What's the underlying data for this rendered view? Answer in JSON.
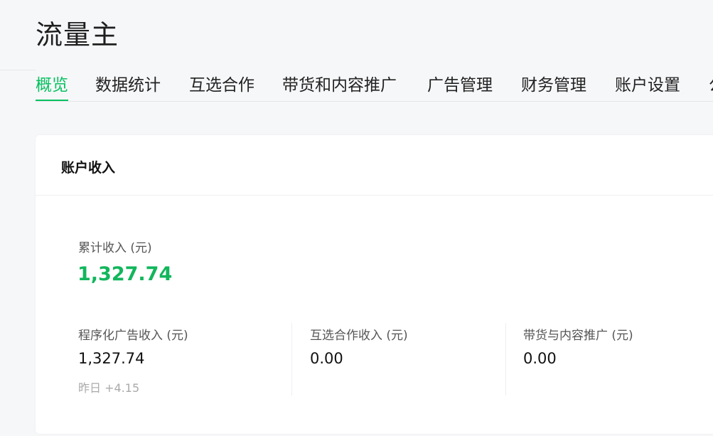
{
  "app": {
    "title": "流量主"
  },
  "tabs": [
    {
      "label": "概览",
      "active": true
    },
    {
      "label": "数据统计"
    },
    {
      "label": "互选合作"
    },
    {
      "label": "带货和内容推广"
    },
    {
      "label": "广告管理"
    },
    {
      "label": "财务管理"
    },
    {
      "label": "账户设置"
    },
    {
      "label": "公"
    }
  ],
  "income_card": {
    "title": "账户收入",
    "total": {
      "label": "累计收入 (元)",
      "value": "1,327.74"
    },
    "metrics": [
      {
        "label": "程序化广告收入 (元)",
        "value": "1,327.74",
        "sub": "昨日 +4.15"
      },
      {
        "label": "互选合作收入 (元)",
        "value": "0.00"
      },
      {
        "label": "带货与内容推广 (元)",
        "value": "0.00"
      }
    ]
  },
  "colors": {
    "accent": "#07c160",
    "total_value": "#12b65c"
  }
}
